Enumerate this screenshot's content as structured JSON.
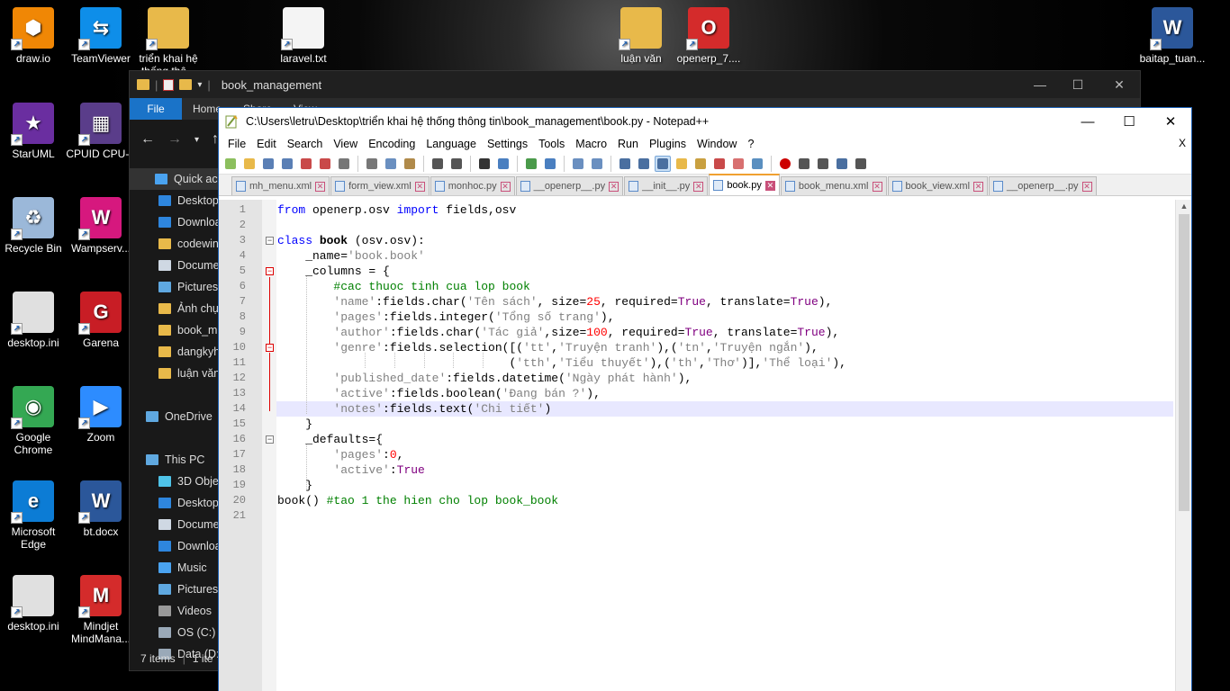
{
  "desktop": {
    "icons": [
      {
        "label": "draw.io",
        "color": "#f08705",
        "glyph": "⬢"
      },
      {
        "label": "TeamViewer",
        "color": "#0e8ee9",
        "glyph": "⇆"
      },
      {
        "label": "triển khai hệ thống thô...",
        "color": "#e8b94a",
        "glyph": ""
      },
      {
        "label": "laravel.txt",
        "color": "#f4f4f4",
        "glyph": ""
      },
      {
        "label": "luận văn",
        "color": "#e8b94a",
        "glyph": ""
      },
      {
        "label": "openerp_7....",
        "color": "#d42b2b",
        "glyph": "O"
      },
      {
        "label": "baitap_tuan...",
        "color": "#2b579a",
        "glyph": "W"
      },
      {
        "label": "StarUML",
        "color": "#6a2ea0",
        "glyph": "★"
      },
      {
        "label": "CPUID CPU-Z",
        "color": "#5a3d8a",
        "glyph": "▦"
      },
      {
        "label": "Recycle Bin",
        "color": "#9bb8d9",
        "glyph": "♻"
      },
      {
        "label": "Wampserv...",
        "color": "#d6187e",
        "glyph": "W"
      },
      {
        "label": "desktop.ini",
        "color": "#e0e0e0",
        "glyph": ""
      },
      {
        "label": "Garena",
        "color": "#c81d25",
        "glyph": "G"
      },
      {
        "label": "Google Chrome",
        "color": "#34a853",
        "glyph": "◉"
      },
      {
        "label": "Zoom",
        "color": "#2d8cff",
        "glyph": "▶"
      },
      {
        "label": "Microsoft Edge",
        "color": "#0c7cd5",
        "glyph": "e"
      },
      {
        "label": "bt.docx",
        "color": "#2b579a",
        "glyph": "W"
      },
      {
        "label": "desktop.ini",
        "color": "#e0e0e0",
        "glyph": ""
      },
      {
        "label": "Mindjet MindMana...",
        "color": "#d42b2b",
        "glyph": "M"
      }
    ]
  },
  "explorer": {
    "title": "book_management",
    "ribbon": {
      "file": "File",
      "tabs": [
        "Home",
        "Share",
        "View"
      ]
    },
    "sidebar": [
      {
        "label": "Quick acce",
        "icon": "star-icon",
        "color": "#4aa3f0"
      },
      {
        "label": "Desktop",
        "icon": "desktop-icon",
        "color": "#2e86de"
      },
      {
        "label": "Downloa",
        "icon": "download-icon",
        "color": "#2e86de"
      },
      {
        "label": "codewin",
        "icon": "folder-icon",
        "color": "#e8b94a"
      },
      {
        "label": "Docume",
        "icon": "document-icon",
        "color": "#cfd8e3"
      },
      {
        "label": "Pictures",
        "icon": "pictures-icon",
        "color": "#5fa8e0"
      },
      {
        "label": "Ảnh chụ",
        "icon": "folder-icon",
        "color": "#e8b94a"
      },
      {
        "label": "book_m",
        "icon": "folder-icon",
        "color": "#e8b94a"
      },
      {
        "label": "dangkyh",
        "icon": "folder-icon",
        "color": "#e8b94a"
      },
      {
        "label": "luận văn",
        "icon": "folder-icon",
        "color": "#e8b94a"
      },
      {
        "label": "",
        "icon": "",
        "color": ""
      },
      {
        "label": "OneDrive",
        "icon": "cloud-icon",
        "color": "#5fa8e0"
      },
      {
        "label": "",
        "icon": "",
        "color": ""
      },
      {
        "label": "This PC",
        "icon": "pc-icon",
        "color": "#5fa8e0"
      },
      {
        "label": "3D Objec",
        "icon": "cube-icon",
        "color": "#4fc3e8"
      },
      {
        "label": "Desktop",
        "icon": "desktop-icon",
        "color": "#2e86de"
      },
      {
        "label": "Docume",
        "icon": "document-icon",
        "color": "#cfd8e3"
      },
      {
        "label": "Downloa",
        "icon": "download-icon",
        "color": "#2e86de"
      },
      {
        "label": "Music",
        "icon": "music-icon",
        "color": "#4aa3f0"
      },
      {
        "label": "Pictures",
        "icon": "pictures-icon",
        "color": "#5fa8e0"
      },
      {
        "label": "Videos",
        "icon": "video-icon",
        "color": "#999999"
      },
      {
        "label": "OS (C:)",
        "icon": "drive-icon",
        "color": "#9aa9b8"
      },
      {
        "label": "Data (D:)",
        "icon": "drive-icon",
        "color": "#9aa9b8"
      }
    ],
    "status": {
      "items": "7 items",
      "selected": "1 ite"
    }
  },
  "npp": {
    "title": "C:\\Users\\letru\\Desktop\\triển khai hệ thống thông tin\\book_management\\book.py - Notepad++",
    "menu": [
      "File",
      "Edit",
      "Search",
      "View",
      "Encoding",
      "Language",
      "Settings",
      "Tools",
      "Macro",
      "Run",
      "Plugins",
      "Window",
      "?"
    ],
    "menu_close": "X",
    "tabs": [
      {
        "label": "mh_menu.xml",
        "active": false
      },
      {
        "label": "form_view.xml",
        "active": false
      },
      {
        "label": "monhoc.py",
        "active": false
      },
      {
        "label": "__openerp__.py",
        "active": false
      },
      {
        "label": "__init__.py",
        "active": false
      },
      {
        "label": "book.py",
        "active": true
      },
      {
        "label": "book_menu.xml",
        "active": false
      },
      {
        "label": "book_view.xml",
        "active": false
      },
      {
        "label": "__openerp__.py",
        "active": false
      }
    ],
    "line_numbers": [
      "1",
      "2",
      "3",
      "4",
      "5",
      "6",
      "7",
      "8",
      "9",
      "10",
      "11",
      "12",
      "13",
      "14",
      "15",
      "16",
      "17",
      "18",
      "19",
      "20",
      "21"
    ],
    "current_line": 14
  }
}
